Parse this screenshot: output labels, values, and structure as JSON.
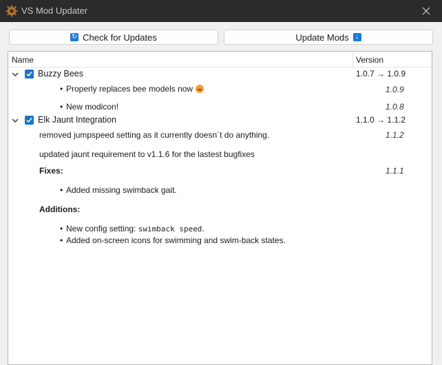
{
  "window": {
    "title": "VS Mod Updater",
    "app_icon": "gear-icon",
    "close_icon": "close-icon"
  },
  "toolbar": {
    "check_label": "Check for Updates",
    "check_icon": "refresh-icon",
    "update_label": "Update Mods",
    "update_icon": "download-icon"
  },
  "tree": {
    "col_name": "Name",
    "col_version": "Version",
    "mods": [
      {
        "name": "Buzzy Bees",
        "version": "1.0.7 → 1.0.9",
        "checked": true,
        "expanded": true,
        "notes": [
          {
            "bullet": "Properly replaces bee models now",
            "emoji": "grinning-face-icon",
            "version": "1.0.9"
          },
          {
            "bullet": "New modicon!",
            "version": "1.0.8"
          }
        ]
      },
      {
        "name": "Elk Jaunt Integration",
        "version": "1.1.0 → 1.1.2",
        "checked": true,
        "expanded": true,
        "notes": [
          {
            "text": "removed jumpspeed setting as it currently doesn´t do anything.",
            "version": "1.1.2"
          },
          {
            "text": "updated jaunt requirement to v1.1.6 for the lastest bugfixes"
          },
          {
            "heading": "Fixes:",
            "version": "1.1.1"
          },
          {
            "bullet": "Added missing swimback gait."
          },
          {
            "heading": "Additions:"
          },
          {
            "bullet_prefix": "New config setting: ",
            "bullet_code": "swimback speed",
            "bullet_suffix": "."
          },
          {
            "bullet": "Added on-screen icons for swimming and swim-back states."
          }
        ]
      }
    ]
  },
  "colors": {
    "titlebar": "#2b2b2b",
    "accent": "#1e73c9",
    "background": "#f0f0f0"
  }
}
